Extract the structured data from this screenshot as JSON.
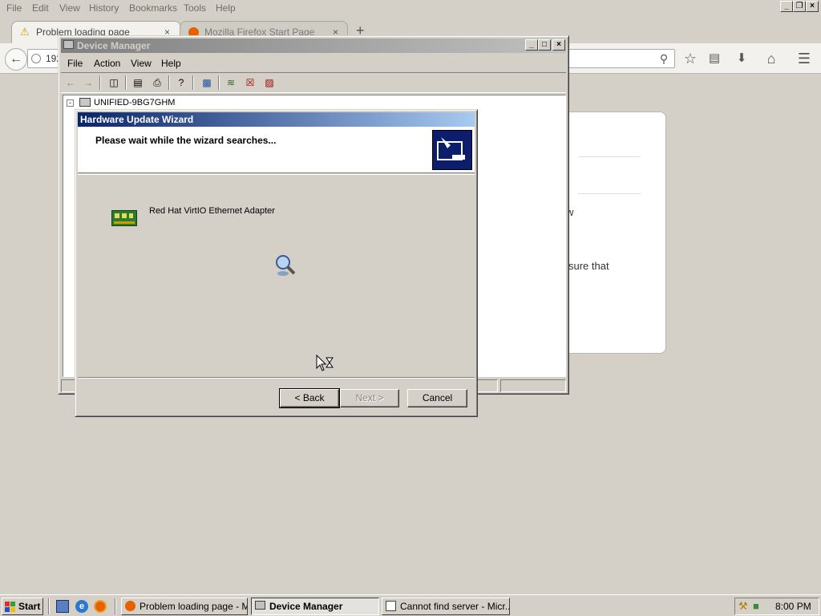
{
  "firefox": {
    "menu": [
      "File",
      "Edit",
      "View",
      "History",
      "Bookmarks",
      "Tools",
      "Help"
    ],
    "tabs": [
      {
        "label": "Problem loading page"
      },
      {
        "label": "Mozilla Firefox Start Page"
      }
    ],
    "new_tab_label": "+",
    "url_text": "192",
    "error_page_fragments": [
      "w",
      "sure that"
    ]
  },
  "device_manager": {
    "title": "Device Manager",
    "menu": [
      "File",
      "Action",
      "View",
      "Help"
    ],
    "tree_root": "UNIFIED-9BG7GHM"
  },
  "wizard": {
    "title": "Hardware Update Wizard",
    "heading": "Please wait while the wizard searches...",
    "device_name": "Red Hat VirtIO Ethernet Adapter",
    "buttons": {
      "back": "< Back",
      "next": "Next >",
      "cancel": "Cancel"
    }
  },
  "taskbar": {
    "start_label": "Start",
    "tasks": [
      {
        "label": "Problem loading page - M..."
      },
      {
        "label": "Device Manager"
      },
      {
        "label": "Cannot find server - Micr..."
      }
    ],
    "clock": "8:00 PM"
  },
  "colors": {
    "active_title_start": "#0a246a",
    "active_title_end": "#a6caf0",
    "inactive_title_start": "#808080",
    "face": "#d4d0c8"
  }
}
